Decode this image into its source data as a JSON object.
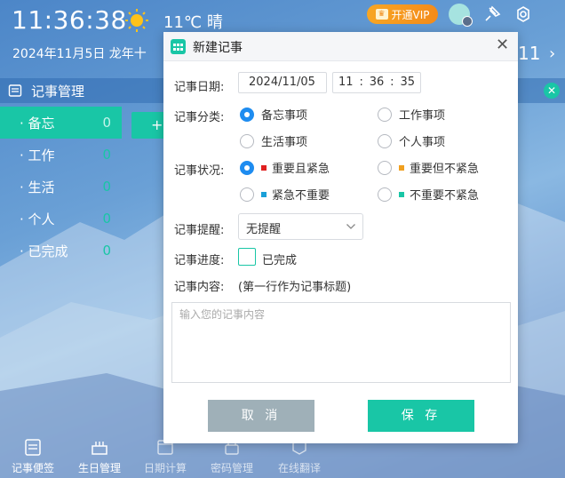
{
  "header": {
    "time": "11:36:38",
    "temperature": "11℃ 晴",
    "date_lunar": "2024年11月5日 龙年十",
    "vip_label": "开通VIP",
    "right_number": "11"
  },
  "panel": {
    "title": "记事管理",
    "categories": [
      {
        "label": "· 备忘",
        "count": "0"
      },
      {
        "label": "· 工作",
        "count": "0"
      },
      {
        "label": "· 生活",
        "count": "0"
      },
      {
        "label": "· 个人",
        "count": "0"
      },
      {
        "label": "· 已完成",
        "count": "0"
      }
    ],
    "add_label": "+"
  },
  "toolbar": {
    "items": [
      "记事便签",
      "生日管理",
      "日期计算",
      "密码管理",
      "在线翻译"
    ]
  },
  "dialog": {
    "title": "新建记事",
    "date_label": "记事日期:",
    "date_value": "2024/11/05",
    "time_hour": "11",
    "time_min": "36",
    "time_sec": "35",
    "category_label": "记事分类:",
    "categories": [
      "备忘事项",
      "工作事项",
      "生活事项",
      "个人事项"
    ],
    "status_label": "记事状况:",
    "statuses": [
      "重要且紧急",
      "重要但不紧急",
      "紧急不重要",
      "不重要不紧急"
    ],
    "reminder_label": "记事提醒:",
    "reminder_value": "无提醒",
    "progress_label": "记事进度:",
    "progress_option": "已完成",
    "content_label": "记事内容:",
    "content_hint": "(第一行作为记事标题)",
    "content_placeholder": "输入您的记事内容",
    "cancel_label": "取 消",
    "save_label": "保 存"
  },
  "colors": {
    "accent": "#19c6a6",
    "radio_selected": "#1e8cf0",
    "status_urgent_important": "#e02020",
    "status_important": "#f0a020",
    "status_urgent": "#1aa0d8",
    "status_neither": "#19c6a6",
    "vip": "#f4951e"
  }
}
